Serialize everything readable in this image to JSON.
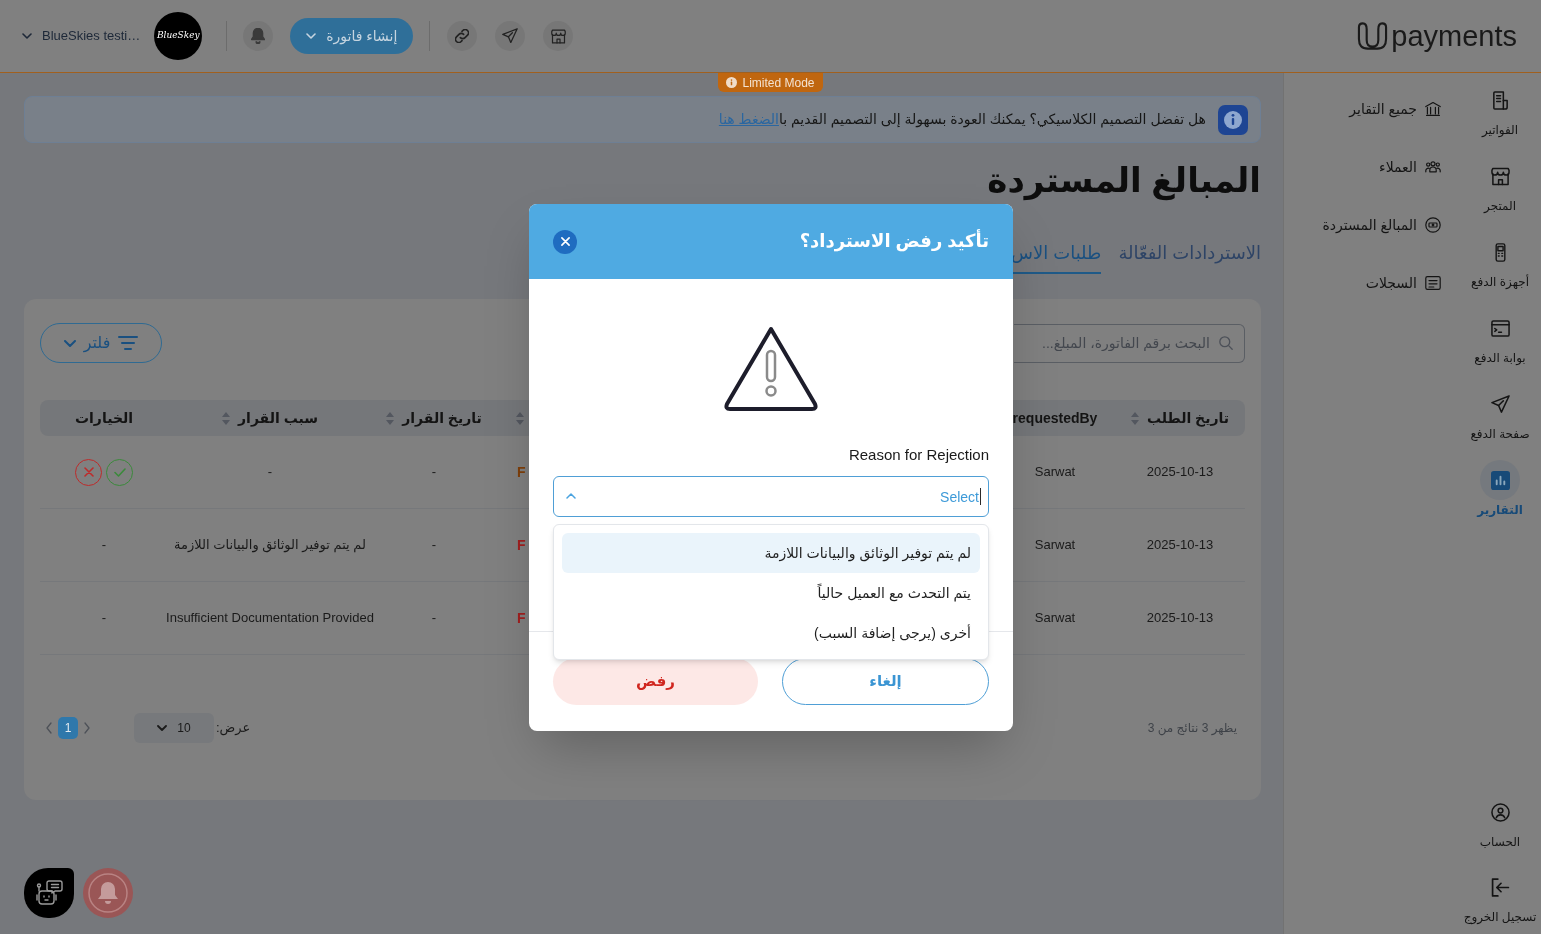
{
  "header": {
    "account_name": "BlueSkies testi…",
    "company_logo_text": "BlueSkey",
    "create_invoice": "إنشاء فاتورة",
    "brand_name": "payments"
  },
  "limited_mode": "Limited Mode",
  "banner": {
    "text": "هل تفضل التصميم الكلاسيكي؟ يمكنك العودة بسهولة إلى التصميم القديم با",
    "link": "الضغط هنا"
  },
  "page_title": "المبالغ المستردة",
  "tabs": [
    {
      "label": "الاستردادات الفعّالة",
      "selected": false
    },
    {
      "label": "طلبات الاس",
      "selected": true
    }
  ],
  "toolbar": {
    "search": {
      "placeholder": "البحث برقم الفاتورة، المبلغ..."
    },
    "filter": "فلتر"
  },
  "table": {
    "columns": [
      {
        "label": "تاريخ الطلب",
        "sortable": true
      },
      {
        "label": "requestedBy",
        "sortable": false
      },
      {
        "sortable": true
      },
      {
        "label": "تاريخ القرار",
        "sortable": true
      },
      {
        "label": "سبب القرار",
        "sortable": true
      },
      {
        "label": "الخيارات",
        "sortable": false
      }
    ],
    "rows": [
      {
        "cells": [
          {
            "kind": "text",
            "text": "2025-10-13"
          },
          {
            "kind": "text",
            "text": "Sarwat"
          },
          {
            "kind": "status",
            "text": "F",
            "color": "#7f3f0a"
          },
          {
            "kind": "text",
            "text": "-"
          },
          {
            "kind": "text",
            "text": "-"
          },
          {
            "kind": "actions"
          }
        ]
      },
      {
        "cells": [
          {
            "kind": "text",
            "text": "2025-10-13"
          },
          {
            "kind": "text",
            "text": "Sarwat"
          },
          {
            "kind": "status",
            "text": "F",
            "color": "#a11f1f"
          },
          {
            "kind": "text",
            "text": "-"
          },
          {
            "kind": "text",
            "text": "لم يتم توفير الوثائق والبيانات اللازمة"
          },
          {
            "kind": "text",
            "text": "-"
          }
        ]
      },
      {
        "cells": [
          {
            "kind": "text",
            "text": "2025-10-13"
          },
          {
            "kind": "text",
            "text": "Sarwat"
          },
          {
            "kind": "status",
            "text": "F",
            "color": "#a11f1f"
          },
          {
            "kind": "text",
            "text": "-"
          },
          {
            "kind": "text",
            "text": "Insufficient Documentation Provided"
          },
          {
            "kind": "text",
            "text": "-"
          }
        ]
      }
    ]
  },
  "pagination": {
    "summary": "يظهر 3 نتائج من 3",
    "page_size_label": "عرض:",
    "page_size": "10",
    "pages": [
      {
        "label": "1",
        "selected": true
      }
    ]
  },
  "sidebar": {
    "items": [
      {
        "label": "الفواتير",
        "selected": false
      },
      {
        "label": "المتجر",
        "selected": false
      },
      {
        "label": "أجهزة الدفع",
        "selected": false
      },
      {
        "label": "بوابة الدفع",
        "selected": false
      },
      {
        "label": "صفحة الدفع",
        "selected": false
      },
      {
        "label": "التقارير",
        "selected": true
      }
    ],
    "bottom_items": [
      {
        "label": "الحساب"
      },
      {
        "label": "تسجيل الخروج"
      }
    ],
    "submenu": [
      "جميع التقاير",
      "العملاء",
      "المبالغ المستردة",
      "السجلات"
    ]
  },
  "modal": {
    "title": "تأكيد رفض الاسترداد؟",
    "field_label": "Reason for Rejection",
    "select": {
      "placeholder": "Select",
      "expanded": true
    },
    "options": [
      {
        "label": "لم يتم توفير الوثائق والبيانات اللازمة",
        "highlighted": true
      },
      {
        "label": "يتم التحدث مع العميل حالياً",
        "highlighted": false
      },
      {
        "label": "أخرى (يرجى إضافة السبب)",
        "highlighted": false
      }
    ],
    "buttons": [
      {
        "label": "إلغاء",
        "kind": "secondary"
      },
      {
        "label": "رفض",
        "kind": "danger"
      }
    ]
  }
}
